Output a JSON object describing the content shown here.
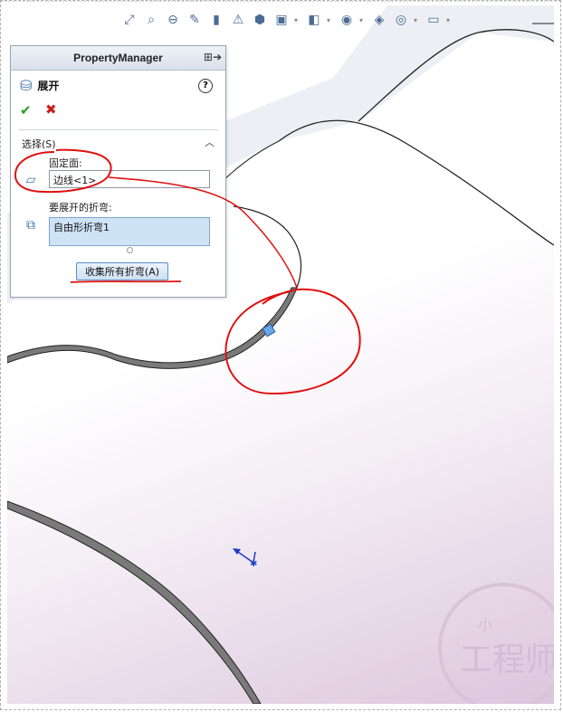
{
  "property_manager": {
    "title": "PropertyManager",
    "feature_title": "展开",
    "help": "?",
    "selection_group": "选择(S)",
    "fixed_face_label": "固定面:",
    "fixed_face_value": "边线<1>",
    "bends_label": "要展开的折弯:",
    "bends_value": "自由形折弯1",
    "collect_button": "收集所有折弯(A)"
  },
  "toolbar": {
    "icons": [
      "zoom-fit-icon",
      "zoom-area-icon",
      "zoom-prev-icon",
      "section-view-icon",
      "view-orient-icon",
      "display-style-icon",
      "hide-show-icon",
      "appearance-icon",
      "scene-icon",
      "view-settings-icon"
    ]
  },
  "colors": {
    "annotation": "#e01010",
    "ok": "#2a9a2a",
    "cancel": "#c81f1f",
    "list_highlight": "#cfe3f6"
  },
  "watermark": "小 工程师"
}
